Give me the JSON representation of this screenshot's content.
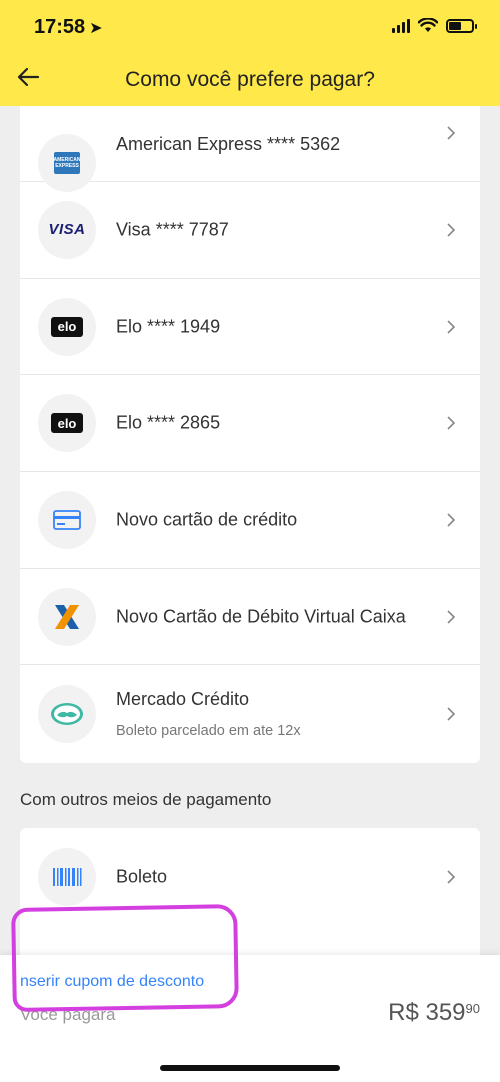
{
  "status_bar": {
    "time": "17:58"
  },
  "header": {
    "title": "Como você prefere pagar?"
  },
  "cards": [
    {
      "label": "American Express **** 5362",
      "icon": "amex-icon"
    },
    {
      "label": "Visa **** 7787",
      "icon": "visa-icon"
    },
    {
      "label": "Elo **** 1949",
      "icon": "elo-icon"
    },
    {
      "label": "Elo **** 2865",
      "icon": "elo-icon"
    },
    {
      "label": "Novo cartão de crédito",
      "icon": "credit-card-icon"
    },
    {
      "label": "Novo Cartão de Débito Virtual Caixa",
      "icon": "caixa-icon"
    },
    {
      "label": "Mercado Crédito",
      "sublabel": "Boleto parcelado em ate 12x",
      "icon": "mercado-credito-icon"
    }
  ],
  "other_section": {
    "title": "Com outros meios de pagamento",
    "items": [
      {
        "label": "Boleto",
        "icon": "barcode-icon"
      }
    ]
  },
  "bottom": {
    "coupon_link": "nserir cupom de desconto",
    "total_label": "Você pagará",
    "total_value": "R$ 359",
    "total_cents": "90"
  },
  "colors": {
    "header_bg": "#fee84a",
    "link": "#3483fa",
    "annotation": "#d43fe0"
  }
}
